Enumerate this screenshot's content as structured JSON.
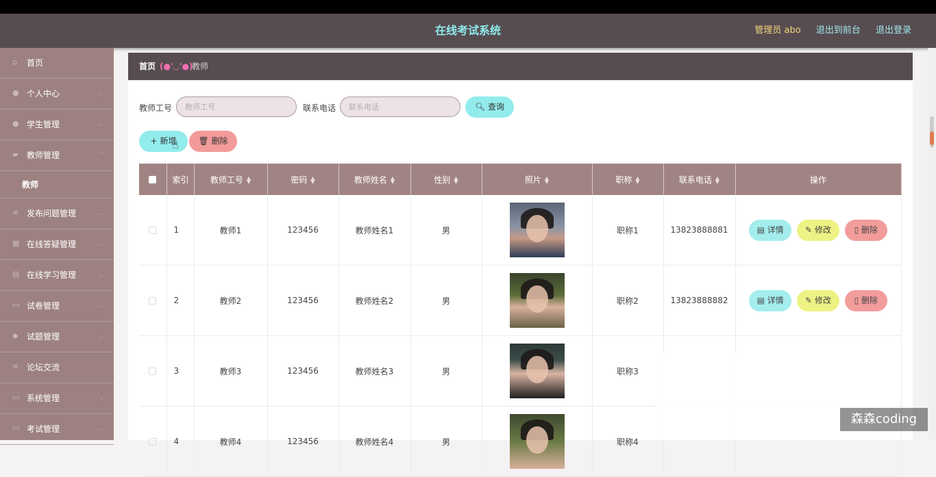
{
  "header": {
    "title": "在线考试系统",
    "admin": "管理员 abo",
    "to_front": "退出到前台",
    "logout": "退出登录"
  },
  "sidebar": {
    "items": [
      {
        "label": "首页",
        "icon": "home-icon"
      },
      {
        "label": "个人中心",
        "icon": "user-icon"
      },
      {
        "label": "学生管理",
        "icon": "user-icon"
      },
      {
        "label": "教师管理",
        "icon": "briefcase-icon"
      },
      {
        "label": "发布问题管理",
        "icon": "list-icon"
      },
      {
        "label": "在线答疑管理",
        "icon": "grid-icon"
      },
      {
        "label": "在线学习管理",
        "icon": "book-icon"
      },
      {
        "label": "试卷管理",
        "icon": "doc-icon"
      },
      {
        "label": "试题管理",
        "icon": "tag-icon"
      },
      {
        "label": "论坛交流",
        "icon": "list-icon"
      },
      {
        "label": "系统管理",
        "icon": "doc-icon"
      },
      {
        "label": "考试管理",
        "icon": "doc-icon"
      }
    ],
    "active_sub": "教师"
  },
  "breadcrumb": {
    "home": "首页",
    "emoticon": "(●'◡'●)",
    "current": "教师"
  },
  "search": {
    "id_label": "教师工号",
    "id_placeholder": "教师工号",
    "phone_label": "联系电话",
    "phone_placeholder": "联系电话",
    "query_label": "查询"
  },
  "actions": {
    "add_label": "新增",
    "delete_label": "删除"
  },
  "table": {
    "headers": [
      "索引",
      "教师工号",
      "密码",
      "教师姓名",
      "性别",
      "照片",
      "职称",
      "联系电话",
      "操作"
    ],
    "row_actions": {
      "detail": "详情",
      "edit": "修改",
      "delete": "删除"
    },
    "rows": [
      {
        "index": "1",
        "id": "教师1",
        "password": "123456",
        "name": "教师姓名1",
        "gender": "男",
        "title": "职称1",
        "phone": "13823888881"
      },
      {
        "index": "2",
        "id": "教师2",
        "password": "123456",
        "name": "教师姓名2",
        "gender": "男",
        "title": "职称2",
        "phone": "13823888882"
      },
      {
        "index": "3",
        "id": "教师3",
        "password": "123456",
        "name": "教师姓名3",
        "gender": "男",
        "title": "职称3",
        "phone": ""
      },
      {
        "index": "4",
        "id": "教师4",
        "password": "123456",
        "name": "教师姓名4",
        "gender": "男",
        "title": "职称4",
        "phone": ""
      }
    ]
  },
  "watermark": "森森coding"
}
